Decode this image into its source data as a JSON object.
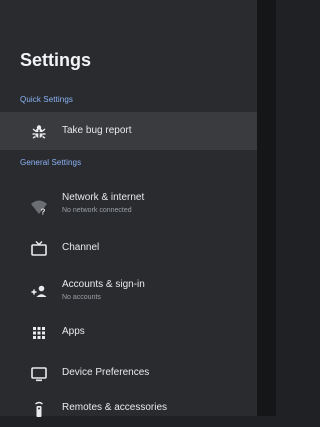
{
  "header": {
    "title": "Settings"
  },
  "quick_settings": {
    "section_label": "Quick Settings",
    "items": [
      {
        "label": "Take bug report",
        "icon": "bug-icon"
      }
    ]
  },
  "general_settings": {
    "section_label": "General Settings",
    "items": [
      {
        "label": "Network & internet",
        "sub": "No network connected",
        "icon": "wifi-off-icon"
      },
      {
        "label": "Channel",
        "icon": "tv-icon"
      },
      {
        "label": "Accounts & sign-in",
        "sub": "No accounts",
        "icon": "add-account-icon"
      },
      {
        "label": "Apps",
        "icon": "apps-grid-icon"
      },
      {
        "label": "Device Preferences",
        "icon": "monitor-icon"
      },
      {
        "label": "Remotes & accessories",
        "icon": "remote-icon"
      }
    ]
  },
  "colors": {
    "panel": "#2a2b2e",
    "focused_row": "#3a3b3e",
    "section_accent": "#8ab4f8"
  }
}
